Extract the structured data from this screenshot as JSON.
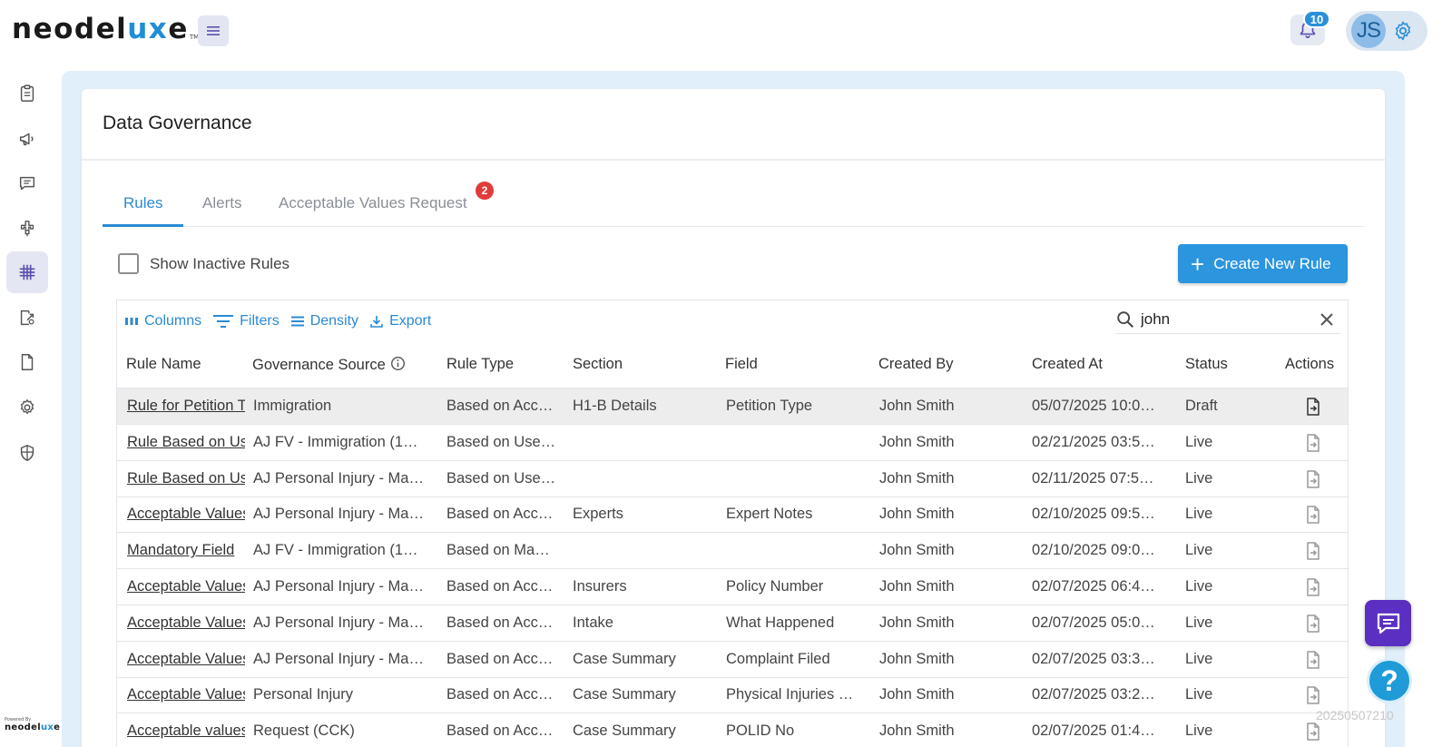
{
  "header": {
    "logo": {
      "part1": "neodel",
      "part2": "ux",
      "part3": "e",
      "tm": "TM"
    },
    "notifications_count": "10",
    "user_initials": "JS"
  },
  "sidebar": {
    "items": [
      {
        "icon": "clipboard-icon"
      },
      {
        "icon": "megaphone-icon"
      },
      {
        "icon": "chat-icon"
      },
      {
        "icon": "connector-icon"
      },
      {
        "icon": "grid-hash-icon",
        "active": true
      },
      {
        "icon": "document-share-icon"
      },
      {
        "icon": "file-icon"
      },
      {
        "icon": "settings-icon"
      },
      {
        "icon": "shield-icon"
      }
    ],
    "powered_by": "Powered By",
    "powered_logo": {
      "part1": "neodel",
      "part2": "ux",
      "part3": "e"
    }
  },
  "page": {
    "title": "Data Governance"
  },
  "tabs": [
    {
      "label": "Rules",
      "active": true
    },
    {
      "label": "Alerts"
    },
    {
      "label": "Acceptable Values Request",
      "badge": "2"
    }
  ],
  "filters": {
    "show_inactive_label": "Show Inactive Rules",
    "create_button": "Create New Rule"
  },
  "toolbar": {
    "columns": "Columns",
    "filters": "Filters",
    "density": "Density",
    "export": "Export",
    "search_value": "john"
  },
  "table": {
    "headers": [
      "Rule Name",
      "Governance Source",
      "Rule Type",
      "Section",
      "Field",
      "Created By",
      "Created At",
      "Status",
      "Actions"
    ],
    "rows": [
      [
        "Rule for Petition Type",
        "Immigration",
        "Based on Acc…",
        "H1-B Details",
        "Petition Type",
        "John Smith",
        "05/07/2025 10:0…",
        "Draft"
      ],
      [
        "Rule Based on User",
        "AJ FV - Immigration (1…",
        "Based on Use…",
        "",
        "",
        "John Smith",
        "02/21/2025 03:5…",
        "Live"
      ],
      [
        "Rule Based on User",
        "AJ Personal Injury - Ma…",
        "Based on Use…",
        "",
        "",
        "John Smith",
        "02/11/2025 07:5…",
        "Live"
      ],
      [
        "Acceptable Values",
        "AJ Personal Injury - Ma…",
        "Based on Acc…",
        "Experts",
        "Expert Notes",
        "John Smith",
        "02/10/2025 09:5…",
        "Live"
      ],
      [
        "Mandatory Field",
        "AJ FV - Immigration (1…",
        "Based on Ma…",
        "",
        "",
        "John Smith",
        "02/10/2025 09:0…",
        "Live"
      ],
      [
        "Acceptable Values",
        "AJ Personal Injury - Ma…",
        "Based on Acc…",
        "Insurers",
        "Policy Number",
        "John Smith",
        "02/07/2025 06:4…",
        "Live"
      ],
      [
        "Acceptable Values",
        "AJ Personal Injury - Ma…",
        "Based on Acc…",
        "Intake",
        "What Happened",
        "John Smith",
        "02/07/2025 05:0…",
        "Live"
      ],
      [
        "Acceptable Values",
        "AJ Personal Injury - Ma…",
        "Based on Acc…",
        "Case Summary",
        "Complaint Filed",
        "John Smith",
        "02/07/2025 03:3…",
        "Live"
      ],
      [
        "Acceptable Values",
        "Personal Injury",
        "Based on Acc…",
        "Case Summary",
        "Physical Injuries …",
        "John Smith",
        "02/07/2025 03:2…",
        "Live"
      ],
      [
        "Acceptable values",
        "Request (CCK)",
        "Based on Acc…",
        "Case Summary",
        "POLID No",
        "John Smith",
        "02/07/2025 01:4…",
        "Live"
      ]
    ]
  },
  "watermark": "20250507210",
  "help_label": "?"
}
